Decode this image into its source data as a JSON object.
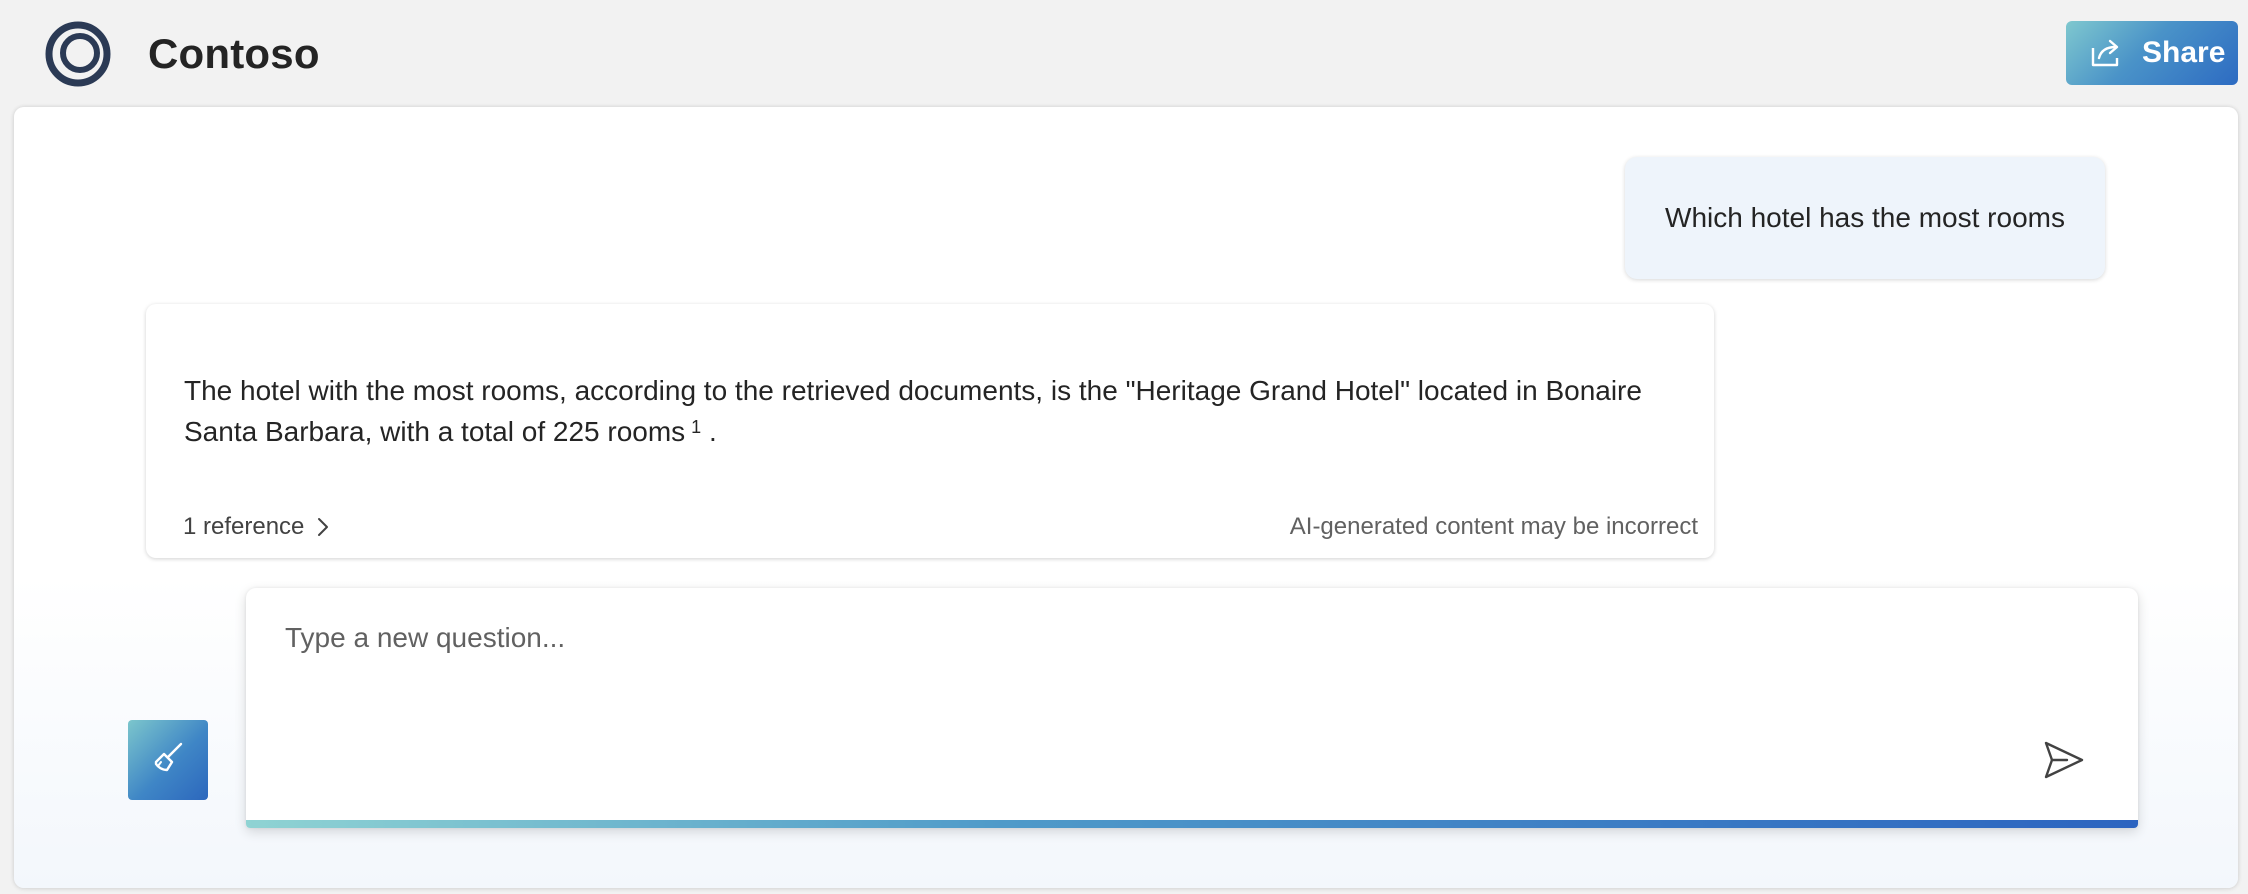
{
  "header": {
    "app_name": "Contoso",
    "share_label": "Share"
  },
  "conversation": {
    "user_message": "Which hotel has the most rooms",
    "answer": {
      "text": "The hotel with the most rooms, according to the retrieved documents, is the \"Heritage Grand Hotel\" located in Bonaire Santa Barbara, with a total of 225 rooms",
      "citation": "1",
      "trailing": ".",
      "references_label": "1 reference",
      "disclaimer": "AI-generated content may be incorrect"
    }
  },
  "composer": {
    "placeholder": "Type a new question...",
    "value": ""
  },
  "icons": {
    "logo": "contoso-ring-logo",
    "share": "share-arrow-icon",
    "references": "chevron-right-icon",
    "clear": "broom-icon",
    "send": "send-icon"
  },
  "colors": {
    "accent_start": "#7fc8cf",
    "accent_end": "#2d6bc2",
    "user_bubble": "#eef4fb",
    "logo": "#2b3a55"
  }
}
